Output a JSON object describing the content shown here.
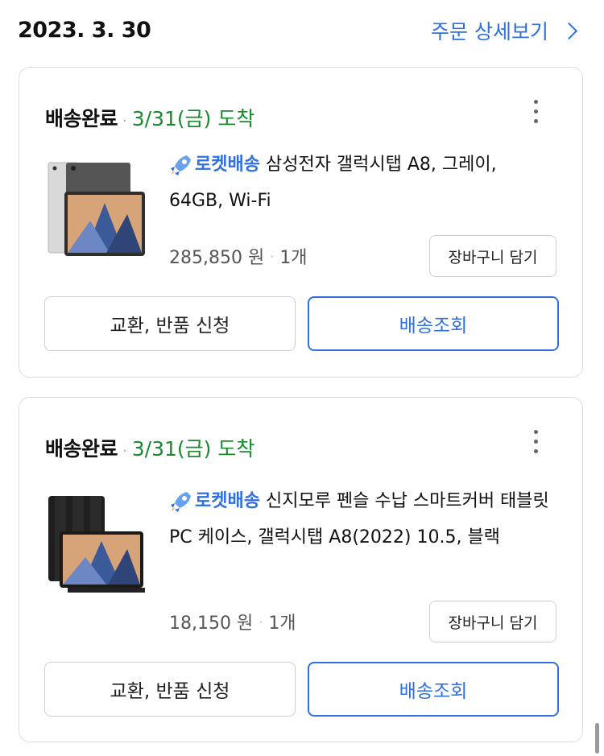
{
  "header": {
    "date": "2023. 3. 30",
    "detail_link": "주문 상세보기"
  },
  "orders": [
    {
      "status": "배송완료",
      "arrival": "3/31(금) 도착",
      "badge": "로켓배송",
      "product_name": "삼성전자 갤럭시탭 A8, 그레이, 64GB, Wi-Fi",
      "price": "285,850 원",
      "quantity": "1개",
      "cart_button": "장바구니 담기",
      "return_button": "교환, 반품 신청",
      "track_button": "배송조회"
    },
    {
      "status": "배송완료",
      "arrival": "3/31(금) 도착",
      "badge": "로켓배송",
      "product_name": "신지모루 펜슬 수납 스마트커버 태블릿 PC 케이스, 갤럭시탭 A8(2022) 10.5, 블랙",
      "price": "18,150 원",
      "quantity": "1개",
      "cart_button": "장바구니 담기",
      "return_button": "교환, 반품 신청",
      "track_button": "배송조회"
    }
  ],
  "colors": {
    "accent": "#2f6fe0",
    "arrival_green": "#1a8a2e",
    "border": "#dcdcdc"
  },
  "icons": [
    "chevron-right-icon",
    "more-vertical-icon",
    "rocket-icon"
  ]
}
